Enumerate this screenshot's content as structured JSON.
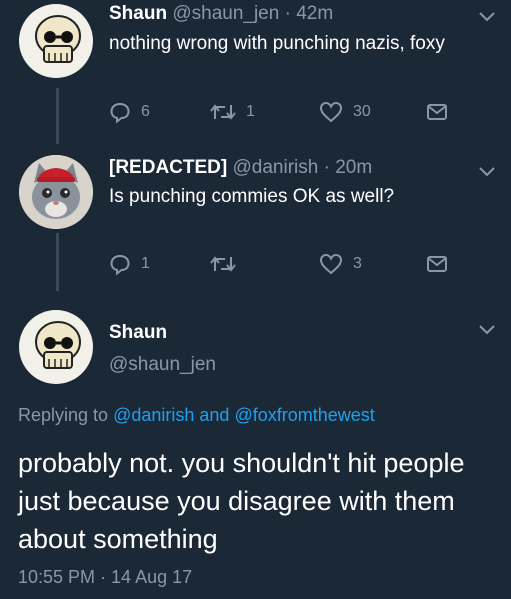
{
  "tweets": [
    {
      "name": "Shaun",
      "handle": "@shaun_jen",
      "sep": "·",
      "time": "42m",
      "text": "nothing wrong with punching nazis, foxy",
      "replies": "6",
      "retweets": "1",
      "likes": "30"
    },
    {
      "name": "[REDACTED]",
      "handle": "@danirish",
      "sep": "·",
      "time": "20m",
      "text": "Is punching commies OK as well?",
      "replies": "1",
      "retweets": "",
      "likes": "3"
    }
  ],
  "main": {
    "name": "Shaun",
    "handle": "@shaun_jen",
    "replying_prefix": "Replying to",
    "mention1": "@danirish",
    "and": "and",
    "mention2": "@foxfromthewest",
    "text": "probably not. you shouldn't hit people just because you disagree with them about something",
    "timestamp": "10:55 PM · 14 Aug 17"
  },
  "colors": {
    "background": "#1b2836",
    "secondary_text": "#8899a6",
    "link": "#1da1f2"
  },
  "icons": [
    "skull-avatar",
    "cat-avatar",
    "reply-icon",
    "retweet-icon",
    "like-icon",
    "message-icon",
    "chevron-down-icon"
  ]
}
